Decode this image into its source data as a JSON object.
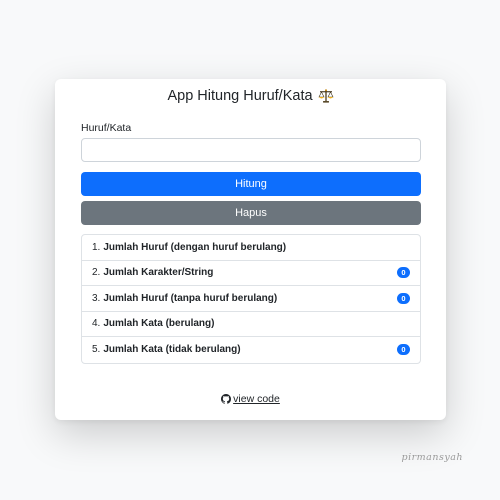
{
  "app": {
    "title": "App Hitung Huruf/Kata",
    "title_icon": "scales-emoji-icon"
  },
  "form": {
    "label": "Huruf/Kata",
    "input_value": "",
    "input_placeholder": ""
  },
  "buttons": {
    "count_label": "Hitung",
    "clear_label": "Hapus"
  },
  "results": [
    {
      "number": "1.",
      "label": "Jumlah Huruf (dengan huruf berulang)",
      "count": null
    },
    {
      "number": "2.",
      "label": "Jumlah Karakter/String",
      "count": "0"
    },
    {
      "number": "3.",
      "label": "Jumlah Huruf (tanpa huruf berulang)",
      "count": "0"
    },
    {
      "number": "4.",
      "label": "Jumlah Kata (berulang)",
      "count": null
    },
    {
      "number": "5.",
      "label": "Jumlah Kata (tidak berulang)",
      "count": "0"
    }
  ],
  "footer": {
    "link_label": " view code",
    "link_icon": "github-icon"
  },
  "signature": "pirmansyah",
  "colors": {
    "primary": "#0d6efd",
    "secondary": "#6c757d",
    "background": "#f8f9fa"
  }
}
